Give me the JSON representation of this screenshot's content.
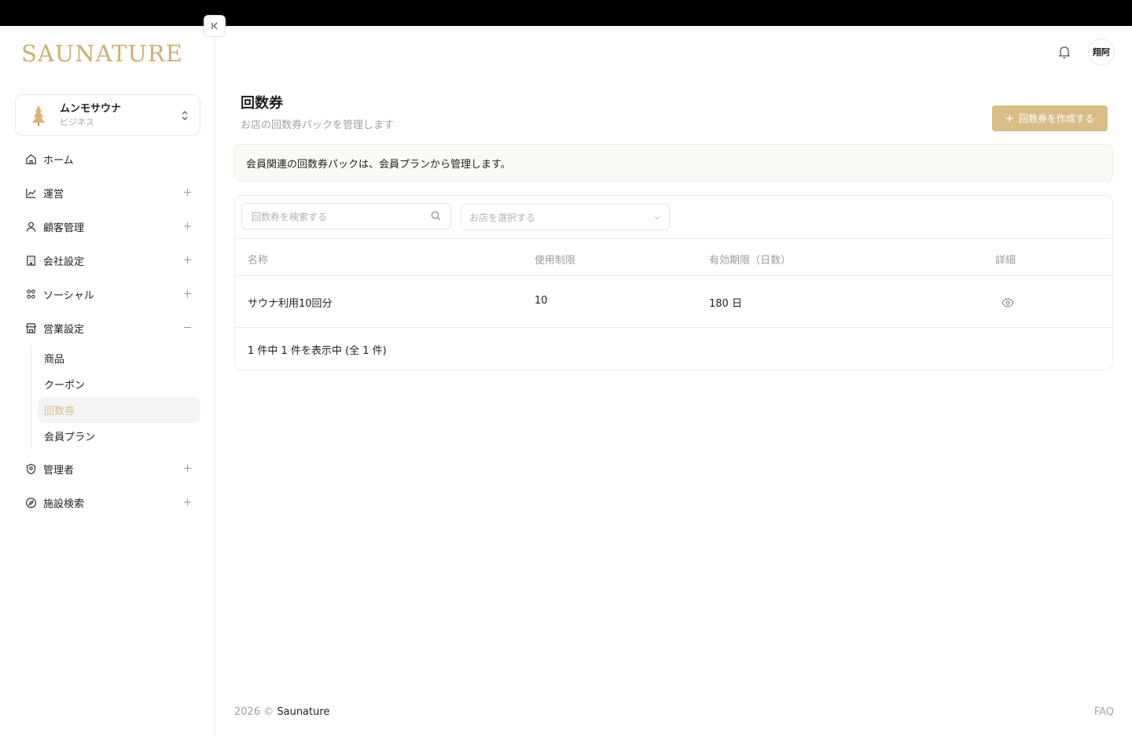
{
  "brand": {
    "logo_text": "SAUNATURE"
  },
  "store": {
    "name": "ムンモサウナ",
    "type": "ビジネス"
  },
  "nav": {
    "home": "ホーム",
    "operations": "運営",
    "customers": "顧客管理",
    "company": "会社設定",
    "social": "ソーシャル",
    "business": "営業設定",
    "business_sub": [
      "商品",
      "クーポン",
      "回数券",
      "会員プラン"
    ],
    "admin": "管理者",
    "facility": "施設検索"
  },
  "header": {
    "avatar_text": "翔阿"
  },
  "page": {
    "title": "回数券",
    "subtitle": "お店の回数券パックを管理します",
    "create_label": "回数券を作成する",
    "notice": "会員関連の回数券パックは、会員プランから管理します。"
  },
  "filters": {
    "search_placeholder": "回数券を検索する",
    "store_placeholder": "お店を選択する"
  },
  "table": {
    "headers": [
      "名称",
      "使用制限",
      "有効期限（日数）",
      "詳細"
    ],
    "rows": [
      {
        "name": "サウナ利用10回分",
        "limit": "10",
        "expiry": "180 日"
      }
    ]
  },
  "pagination": "1 件中 1 件を表示中 (全 1 件)",
  "footer": {
    "copyright": "2026 ©",
    "brand": "Saunature",
    "faq": "FAQ"
  },
  "colors": {
    "accent": "#d8bd87",
    "logo": "#cfae72",
    "active_text": "#d8bd8a"
  }
}
